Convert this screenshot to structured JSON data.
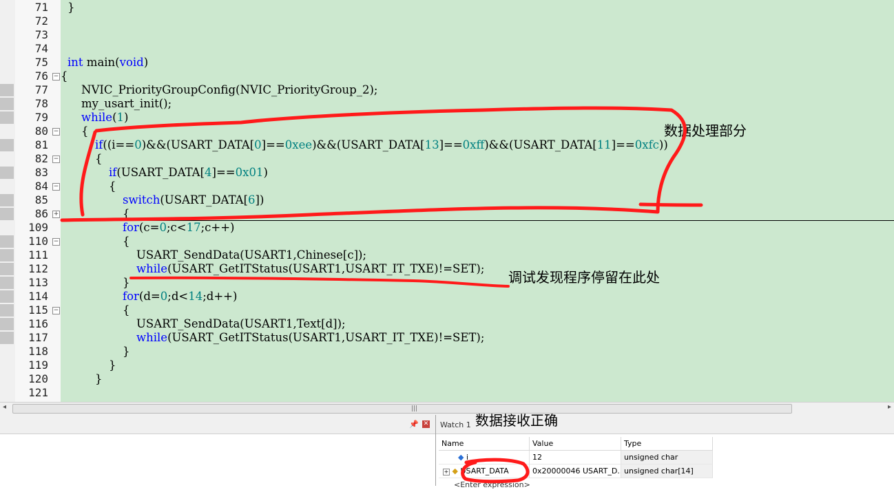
{
  "editor": {
    "lines": [
      {
        "n": "71",
        "fold": "",
        "html": "<span>}</span>"
      },
      {
        "n": "72",
        "fold": "",
        "html": ""
      },
      {
        "n": "73",
        "fold": "",
        "html": ""
      },
      {
        "n": "74",
        "fold": "",
        "html": ""
      },
      {
        "n": "75",
        "fold": "",
        "html": ""
      },
      {
        "n": "76",
        "fold": "minus",
        "html": ""
      },
      {
        "n": "77",
        "fold": "",
        "html": ""
      },
      {
        "n": "78",
        "fold": "",
        "html": ""
      },
      {
        "n": "79",
        "fold": "",
        "html": ""
      },
      {
        "n": "80",
        "fold": "minus",
        "html": ""
      },
      {
        "n": "81",
        "fold": "",
        "html": ""
      },
      {
        "n": "82",
        "fold": "minus",
        "html": ""
      },
      {
        "n": "83",
        "fold": "",
        "html": ""
      },
      {
        "n": "84",
        "fold": "minus",
        "html": ""
      },
      {
        "n": "85",
        "fold": "",
        "html": ""
      },
      {
        "n": "86",
        "fold": "plus",
        "html": ""
      },
      {
        "n": "109",
        "fold": "",
        "html": ""
      },
      {
        "n": "110",
        "fold": "minus",
        "html": ""
      },
      {
        "n": "111",
        "fold": "",
        "html": ""
      },
      {
        "n": "112",
        "fold": "",
        "html": ""
      },
      {
        "n": "113",
        "fold": "",
        "html": ""
      },
      {
        "n": "114",
        "fold": "",
        "html": ""
      },
      {
        "n": "115",
        "fold": "minus",
        "html": ""
      },
      {
        "n": "116",
        "fold": "",
        "html": ""
      },
      {
        "n": "117",
        "fold": "",
        "html": ""
      },
      {
        "n": "118",
        "fold": "",
        "html": ""
      },
      {
        "n": "119",
        "fold": "",
        "html": ""
      },
      {
        "n": "120",
        "fold": "",
        "html": ""
      },
      {
        "n": "121",
        "fold": "",
        "html": ""
      }
    ],
    "code": [
      {
        "t": "}",
        "i": 0
      },
      {
        "t": "",
        "i": 0
      },
      {
        "t": "",
        "i": 0
      },
      {
        "t": "",
        "i": 0
      },
      {
        "t": "int main(void)",
        "i": 0
      },
      {
        "t": "{",
        "i": -0.5
      },
      {
        "t": "NVIC_PriorityGroupConfig(NVIC_PriorityGroup_2);",
        "i": 1
      },
      {
        "t": "my_usart_init();",
        "i": 1
      },
      {
        "t": "while(1)",
        "i": 1
      },
      {
        "t": "{",
        "i": 1
      },
      {
        "t": "if((i==0)&&(USART_DATA[0]==0xee)&&(USART_DATA[13]==0xff)&&(USART_DATA[11]==0xfc))",
        "i": 2
      },
      {
        "t": "{",
        "i": 2
      },
      {
        "t": "if(USART_DATA[4]==0x01)",
        "i": 3
      },
      {
        "t": "{",
        "i": 3
      },
      {
        "t": "switch(USART_DATA[6])",
        "i": 4
      },
      {
        "t": "{",
        "i": 4
      },
      {
        "t": "for(c=0;c<17;c++)",
        "i": 4
      },
      {
        "t": "{",
        "i": 4
      },
      {
        "t": "USART_SendData(USART1,Chinese[c]);",
        "i": 5
      },
      {
        "t": "while(USART_GetITStatus(USART1,USART_IT_TXE)!=SET);",
        "i": 5
      },
      {
        "t": "}",
        "i": 4
      },
      {
        "t": "for(d=0;d<14;d++)",
        "i": 4
      },
      {
        "t": "{",
        "i": 4
      },
      {
        "t": "USART_SendData(USART1,Text[d]);",
        "i": 5
      },
      {
        "t": "while(USART_GetITStatus(USART1,USART_IT_TXE)!=SET);",
        "i": 5
      },
      {
        "t": "}",
        "i": 4
      },
      {
        "t": "}",
        "i": 3
      },
      {
        "t": "}",
        "i": 2
      },
      {
        "t": "",
        "i": 0
      }
    ]
  },
  "annotations": {
    "data_processing": "数据处理部分",
    "stuck_here": "调试发现程序停留在此处",
    "data_received": "数据接收正确"
  },
  "watch": {
    "title": "Watch 1",
    "columns": {
      "name": "Name",
      "value": "Value",
      "type": "Type"
    },
    "rows": [
      {
        "name": "i",
        "value": "12",
        "type": "unsigned char"
      },
      {
        "name": "USART_DATA",
        "value": "0x20000046 USART_D...",
        "type": "unsigned char[14]"
      }
    ],
    "enter_expression": "<Enter expression>"
  },
  "colors": {
    "editor_bg": "#cce8cf",
    "keyword": "#0000ff",
    "number": "#008080",
    "annotation_ink": "#ff1a1a"
  }
}
